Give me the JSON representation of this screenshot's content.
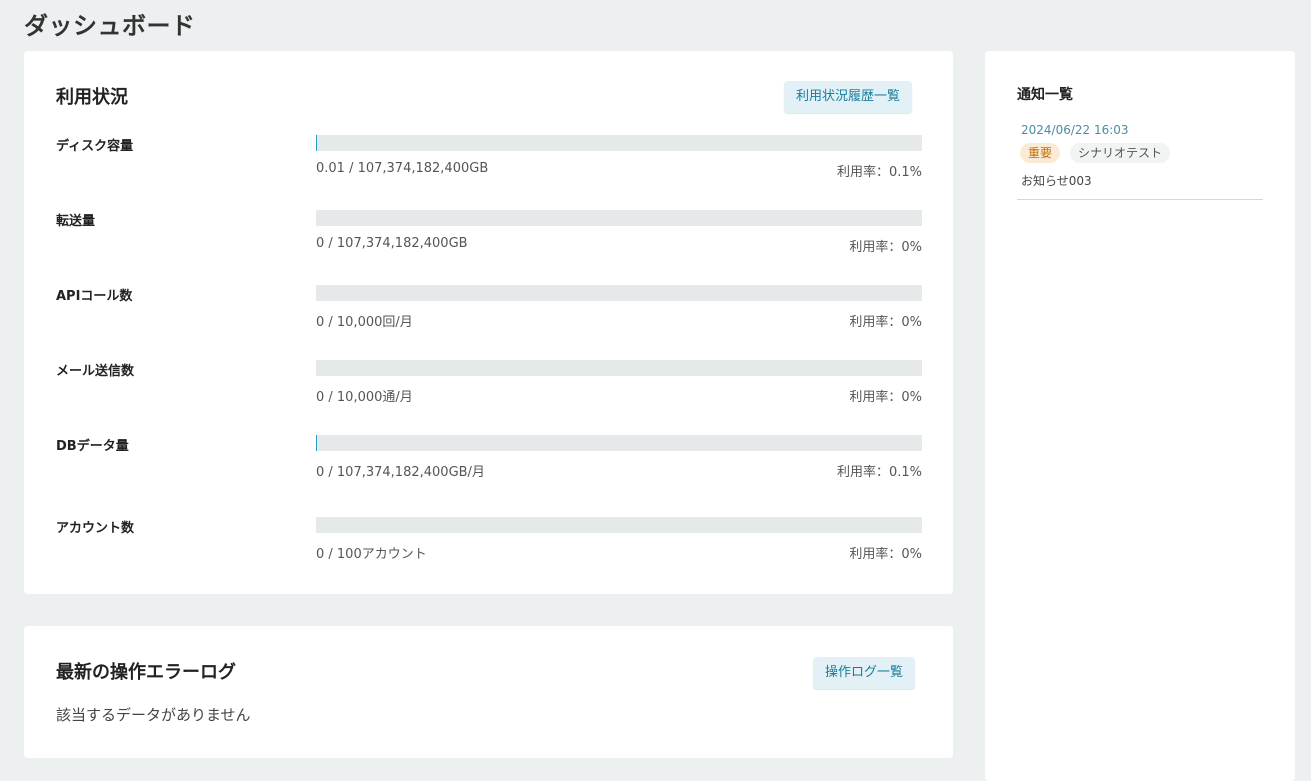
{
  "page": {
    "title": "ダッシュボード"
  },
  "usage": {
    "title": "利用状況",
    "history_button": "利用状況履歴一覧",
    "items": [
      {
        "label": "ディスク容量",
        "amount": "0.01 / 107,374,182,400GB",
        "rate": "利用率：0.1%",
        "fill": 0.001
      },
      {
        "label": "転送量",
        "amount": "0 / 107,374,182,400GB",
        "rate": "利用率：0%",
        "fill": 0
      },
      {
        "label": "APIコール数",
        "amount": "0 / 10,000回/月",
        "rate": "利用率：0%",
        "fill": 0
      },
      {
        "label": "メール送信数",
        "amount": "0 / 10,000通/月",
        "rate": "利用率：0%",
        "fill": 0
      },
      {
        "label": "DBデータ量",
        "amount": "0 / 107,374,182,400GB/月",
        "rate": "利用率：0.1%",
        "fill": 0.001
      },
      {
        "label": "アカウント数",
        "amount": "0 / 100アカウント",
        "rate": "利用率：0%",
        "fill": 0
      }
    ]
  },
  "error_log": {
    "title": "最新の操作エラーログ",
    "list_button": "操作ログ一覧",
    "empty_text": "該当するデータがありません"
  },
  "notices": {
    "title": "通知一覧",
    "items": [
      {
        "date": "2024/06/22 16:03",
        "tags": [
          "重要",
          "シナリオテスト"
        ],
        "text": "お知らせ003"
      }
    ]
  }
}
